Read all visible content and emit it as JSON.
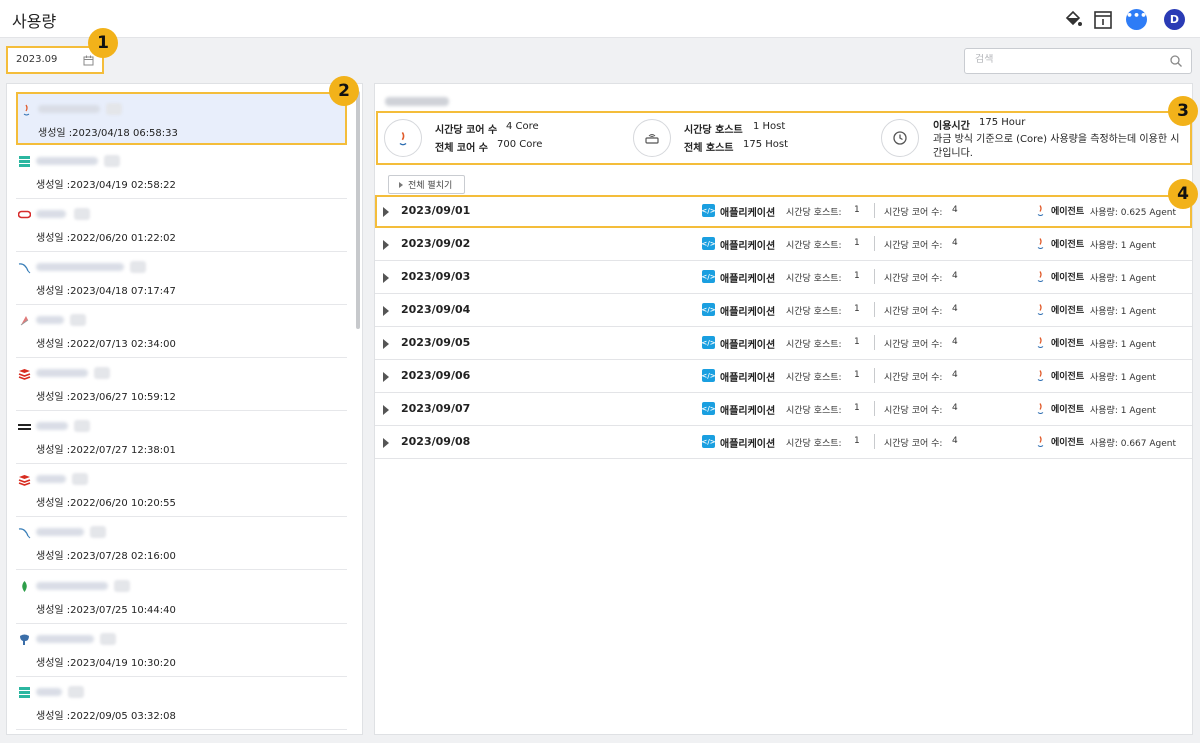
{
  "header": {
    "title": "사용량",
    "avatar_initial": "D"
  },
  "filters": {
    "date_value": "2023.09",
    "search_placeholder": "검색"
  },
  "badges": [
    "1",
    "2",
    "3",
    "4"
  ],
  "left_list": {
    "items": [
      {
        "icon": "java-icon",
        "created": "생성일 :2023/04/18 06:58:33",
        "selected": true
      },
      {
        "icon": "server-icon",
        "created": "생성일 :2023/04/19 02:58:22"
      },
      {
        "icon": "oracle-icon",
        "created": "생성일 :2022/06/20 01:22:02"
      },
      {
        "icon": "mysql-icon",
        "created": "생성일 :2023/04/18 07:17:47"
      },
      {
        "icon": "scouter-icon",
        "created": "생성일 :2022/07/13 02:34:00"
      },
      {
        "icon": "redis-icon",
        "created": "생성일 :2023/06/27 10:59:12"
      },
      {
        "icon": "tibero-icon",
        "created": "생성일 :2022/07/27 12:38:01"
      },
      {
        "icon": "redis-icon",
        "created": "생성일 :2022/06/20 10:20:55"
      },
      {
        "icon": "mysql-icon",
        "created": "생성일 :2023/07/28 02:16:00"
      },
      {
        "icon": "mongodb-icon",
        "created": "생성일 :2023/07/25 10:44:40"
      },
      {
        "icon": "postgres-icon",
        "created": "생성일 :2023/04/19 10:30:20"
      },
      {
        "icon": "server-icon",
        "created": "생성일 :2022/09/05 03:32:08"
      }
    ]
  },
  "summary": {
    "core_per_hour_label": "시간당 코어 수",
    "core_per_hour_value": "4 Core",
    "total_core_label": "전체 코어 수",
    "total_core_value": "700 Core",
    "host_per_hour_label": "시간당 호스트",
    "host_per_hour_value": "1 Host",
    "total_host_label": "전체 호스트",
    "total_host_value": "175 Host",
    "usage_time_label": "이용시간",
    "usage_time_value": "175 Hour",
    "usage_time_desc": "과금 방식 기준으로 (Core) 사용량을 측정하는데 이용한 시간입니다."
  },
  "expand_all_label": "전체 펼치기",
  "row_labels": {
    "application": "애플리케이션",
    "host_per_hour": "시간당 호스트:",
    "core_per_hour": "시간당 코어 수:",
    "agent": "에이전트"
  },
  "days": [
    {
      "date": "2023/09/01",
      "hosts": "1",
      "cores": "4",
      "agent_usage": "사용량: 0.625 Agent"
    },
    {
      "date": "2023/09/02",
      "hosts": "1",
      "cores": "4",
      "agent_usage": "사용량: 1 Agent"
    },
    {
      "date": "2023/09/03",
      "hosts": "1",
      "cores": "4",
      "agent_usage": "사용량: 1 Agent"
    },
    {
      "date": "2023/09/04",
      "hosts": "1",
      "cores": "4",
      "agent_usage": "사용량: 1 Agent"
    },
    {
      "date": "2023/09/05",
      "hosts": "1",
      "cores": "4",
      "agent_usage": "사용량: 1 Agent"
    },
    {
      "date": "2023/09/06",
      "hosts": "1",
      "cores": "4",
      "agent_usage": "사용량: 1 Agent"
    },
    {
      "date": "2023/09/07",
      "hosts": "1",
      "cores": "4",
      "agent_usage": "사용량: 1 Agent"
    },
    {
      "date": "2023/09/08",
      "hosts": "1",
      "cores": "4",
      "agent_usage": "사용량: 0.667 Agent"
    }
  ],
  "colors": {
    "highlight": "#f4bd3a",
    "badge": "#f2b21a",
    "avatar": "#2a3bb5",
    "selected_bg": "#e8eefb"
  }
}
